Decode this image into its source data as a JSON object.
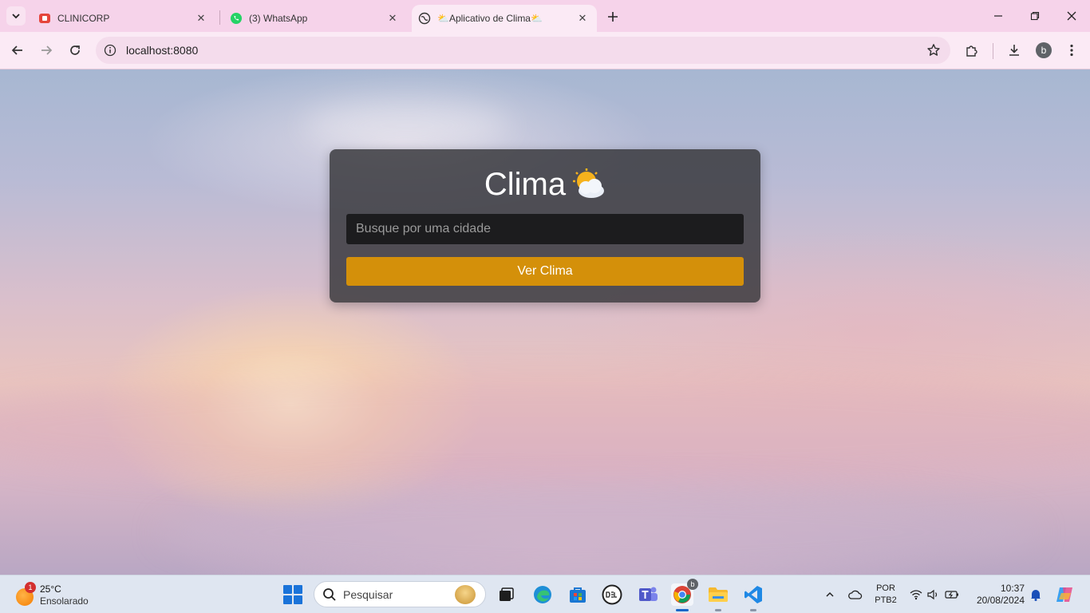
{
  "browser": {
    "tabs": [
      {
        "title": "CLINICORP",
        "icon": "clinicorp-icon"
      },
      {
        "title": "(3) WhatsApp",
        "icon": "whatsapp-icon"
      },
      {
        "title": "⛅Aplicativo de Clima⛅",
        "icon": "globe-icon",
        "active": true
      }
    ],
    "url": "localhost:8080",
    "profile_initial": "b"
  },
  "app": {
    "title": "Clima",
    "title_icon": "sun-behind-cloud-icon",
    "search_placeholder": "Busque por uma cidade",
    "search_value": "",
    "button_label": "Ver Clima"
  },
  "taskbar": {
    "weather": {
      "temp": "25°C",
      "condition": "Ensolarado",
      "badge": "1"
    },
    "search_label": "Pesquisar",
    "language": {
      "line1": "POR",
      "line2": "PTB2"
    },
    "time": "10:37",
    "date": "20/08/2024",
    "chrome_badge": "b"
  },
  "colors": {
    "card_bg": "#343438",
    "input_bg": "#1c1c1e",
    "button": "#d4900a",
    "tabstrip": "#f6d3ea"
  }
}
